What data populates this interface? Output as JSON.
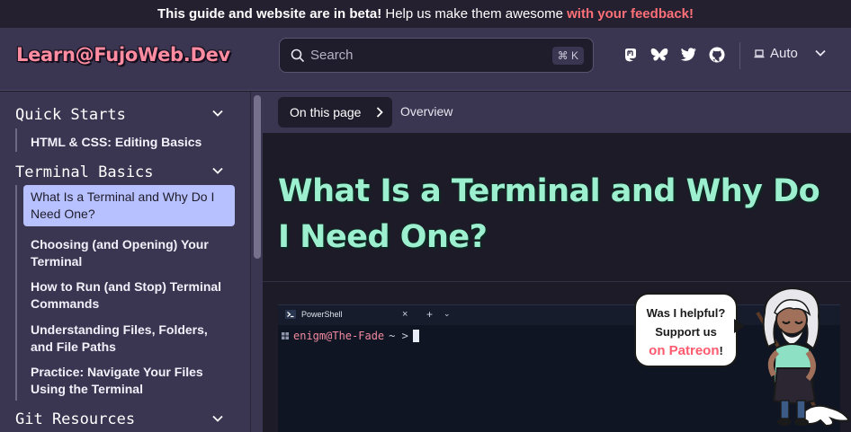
{
  "banner": {
    "bold": "This guide and website are in beta!",
    "middle": " Help us make them awesome ",
    "link": "with your feedback!"
  },
  "header": {
    "logo": "Learn@FujoWeb.Dev",
    "search_placeholder": "Search",
    "search_shortcut": "⌘ K",
    "social": [
      "mastodon-icon",
      "bluesky-icon",
      "twitter-icon",
      "github-icon"
    ],
    "theme_label": "Auto"
  },
  "sidebar": {
    "sections": [
      {
        "title": "Quick Starts",
        "items": [
          "HTML & CSS: Editing Basics"
        ]
      },
      {
        "title": "Terminal Basics",
        "items": [
          "What Is a Terminal and Why Do I Need One?",
          "Choosing (and Opening) Your Terminal",
          "How to Run (and Stop) Terminal Commands",
          "Understanding Files, Folders, and File Paths",
          "Practice: Navigate Your Files Using the Terminal"
        ],
        "active_index": 0
      },
      {
        "title": "Git Resources",
        "items": []
      }
    ]
  },
  "toc": {
    "button": "On this page",
    "current": "Overview"
  },
  "main": {
    "title": "What Is a Terminal and Why Do I Need One?",
    "terminal": {
      "tab": "PowerShell",
      "close": "×",
      "plus": "+",
      "dropdown": "⌄",
      "prompt_user": "enigm@The-Fade",
      "prompt_path": "~ >"
    }
  },
  "patreon": {
    "line1": "Was I helpful?",
    "line2": "Support us",
    "link": "on Patreon",
    "bang": "!"
  },
  "colors": {
    "accent_title": "#9df0cf",
    "logo": "#ff8ca0",
    "feedback": "#ff7079",
    "active_item": "#b8c1ff",
    "header_bg": "#3a3550"
  }
}
